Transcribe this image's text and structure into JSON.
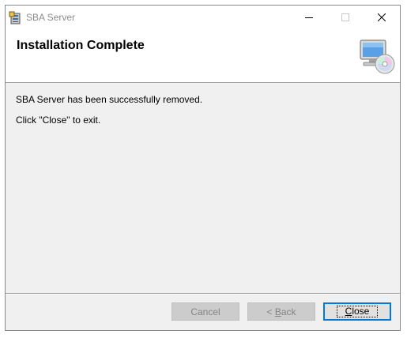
{
  "window": {
    "title": "SBA Server"
  },
  "banner": {
    "title": "Installation Complete",
    "icon": "computer-cd-icon"
  },
  "content": {
    "message1": "SBA Server has been successfully removed.",
    "message2": "Click \"Close\" to exit."
  },
  "buttons": {
    "cancel": "Cancel",
    "back_prefix": "< ",
    "back_accel": "B",
    "back_rest": "ack",
    "close_accel": "C",
    "close_rest": "lose"
  },
  "colors": {
    "focus_border": "#0078d7",
    "disabled_bg": "#cccccc"
  }
}
